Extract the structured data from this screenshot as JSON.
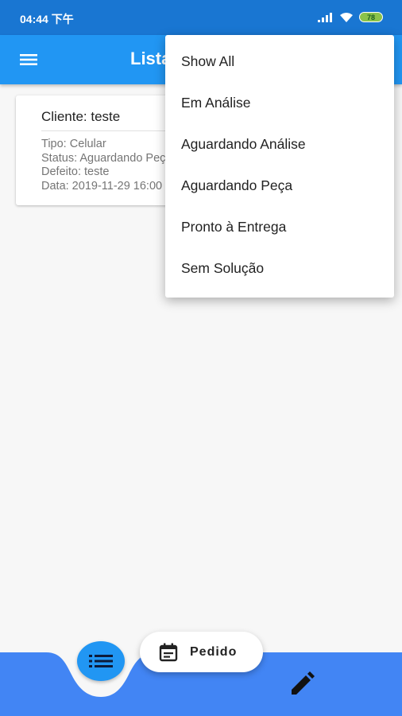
{
  "status_bar": {
    "time": "04:44 下午",
    "battery": "78"
  },
  "app_bar": {
    "title": "Lista de Pedidos"
  },
  "card": {
    "title": "Cliente: teste",
    "lines": [
      "Tipo: Celular",
      "Status: Aguardando Peça",
      "Defeito: teste",
      "Data: 2019-11-29 16:00"
    ]
  },
  "dropdown": {
    "items": [
      "Show All",
      "Em Análise",
      "Aguardando Análise",
      "Aguardando Peça",
      "Pronto à Entrega",
      "Sem Solução"
    ]
  },
  "bottom": {
    "pedido_label": "Pedido"
  },
  "colors": {
    "primary": "#2196f3",
    "status_bar": "#1976d2",
    "bottom_bar": "#4285f4"
  }
}
